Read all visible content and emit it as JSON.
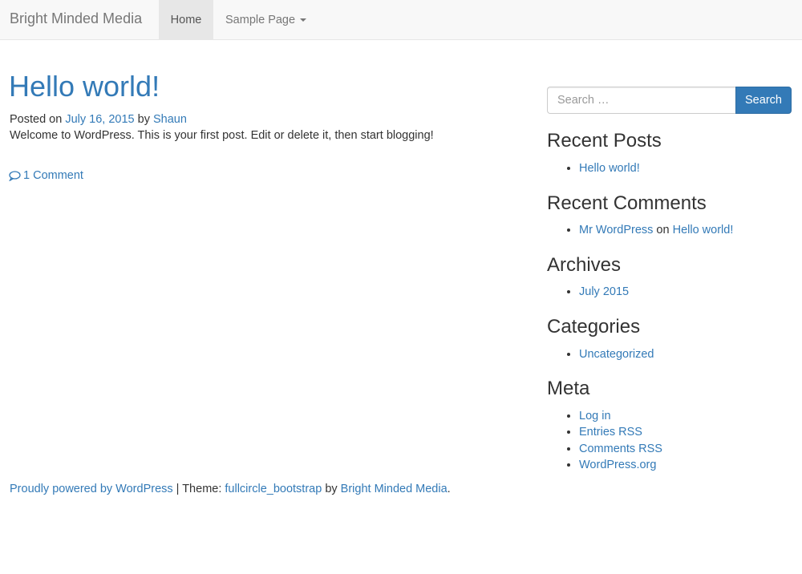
{
  "navbar": {
    "brand": "Bright Minded Media",
    "items": [
      {
        "label": "Home"
      },
      {
        "label": "Sample Page"
      }
    ]
  },
  "post": {
    "title": "Hello world!",
    "meta_prefix": "Posted on",
    "date": "July 16, 2015",
    "by": "by",
    "author": "Shaun",
    "body": "Welcome to WordPress. This is your first post. Edit or delete it, then start blogging!",
    "comments_link": "1 Comment"
  },
  "sidebar": {
    "search": {
      "placeholder": "Search …",
      "button_label": "Search"
    },
    "recent_posts": {
      "title": "Recent Posts",
      "items": [
        "Hello world!"
      ]
    },
    "recent_comments": {
      "title": "Recent Comments",
      "items": [
        {
          "author": "Mr WordPress",
          "on": "on",
          "post": "Hello world!"
        }
      ]
    },
    "archives": {
      "title": "Archives",
      "items": [
        "July 2015"
      ]
    },
    "categories": {
      "title": "Categories",
      "items": [
        "Uncategorized"
      ]
    },
    "meta": {
      "title": "Meta",
      "items": [
        "Log in",
        "Entries RSS",
        "Comments RSS",
        "WordPress.org"
      ]
    }
  },
  "footer": {
    "powered": "Proudly powered by WordPress",
    "sep": " | Theme: ",
    "theme": "fullcircle_bootstrap",
    "by": " by ",
    "author": "Bright Minded Media",
    "end": "."
  },
  "colors": {
    "link": "#337ab7",
    "navbar_bg": "#f8f8f8",
    "active_nav": "#e7e7e7",
    "button": "#337ab7"
  },
  "icons": {
    "comment": "comment-bubble-icon",
    "caret": "caret-down-icon"
  }
}
